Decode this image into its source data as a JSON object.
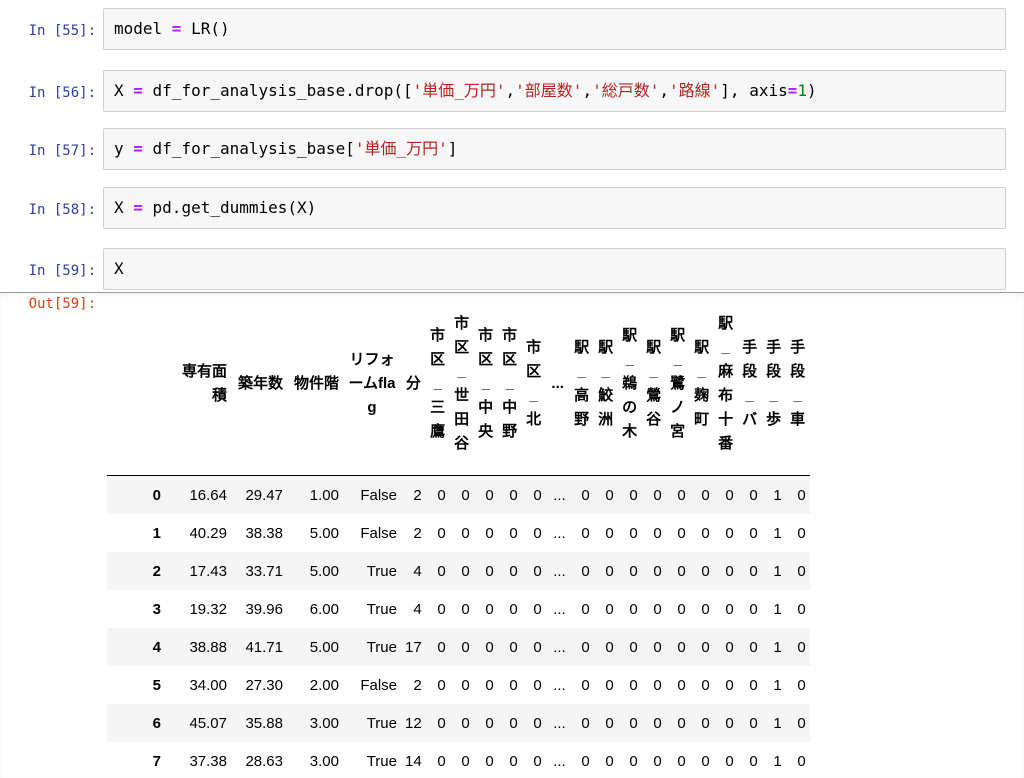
{
  "cells": [
    {
      "prompt": "In [55]:",
      "tokens": [
        [
          "t",
          "model "
        ],
        [
          "kw",
          "="
        ],
        [
          "t",
          " LR()"
        ]
      ]
    },
    {
      "prompt": "In [56]:",
      "tokens": [
        [
          "t",
          "X "
        ],
        [
          "kw",
          "="
        ],
        [
          "t",
          " df_for_analysis_base.drop(["
        ],
        [
          "str",
          "'単価_万円'"
        ],
        [
          "t",
          ","
        ],
        [
          "str",
          "'部屋数'"
        ],
        [
          "t",
          ","
        ],
        [
          "str",
          "'総戸数'"
        ],
        [
          "t",
          ","
        ],
        [
          "str",
          "'路線'"
        ],
        [
          "t",
          "], axis"
        ],
        [
          "kw",
          "="
        ],
        [
          "num",
          "1"
        ],
        [
          "t",
          ")"
        ]
      ]
    },
    {
      "prompt": "In [57]:",
      "tokens": [
        [
          "t",
          "y "
        ],
        [
          "kw",
          "="
        ],
        [
          "t",
          " df_for_analysis_base["
        ],
        [
          "str",
          "'単価_万円'"
        ],
        [
          "t",
          "]"
        ]
      ]
    },
    {
      "prompt": "In [58]:",
      "tokens": [
        [
          "t",
          "X "
        ],
        [
          "kw",
          "="
        ],
        [
          "t",
          " pd.get_dummies(X)"
        ]
      ]
    },
    {
      "prompt": "In [59]:",
      "tokens": [
        [
          "t",
          "X"
        ]
      ]
    }
  ],
  "output": {
    "prompt": "Out[59]:",
    "columns": [
      {
        "label": "専有面積",
        "style": "wrap"
      },
      {
        "label": "築年数",
        "style": "wrap"
      },
      {
        "label": "物件階",
        "style": "wrap"
      },
      {
        "label": "リフォームflag",
        "style": "reform"
      },
      {
        "label": "分",
        "style": "vt"
      },
      {
        "label": "市区_三鷹",
        "style": "vt"
      },
      {
        "label": "市区_世田谷",
        "style": "vt"
      },
      {
        "label": "市区_中央",
        "style": "vt"
      },
      {
        "label": "市区_中野",
        "style": "vt"
      },
      {
        "label": "市区_北",
        "style": "vt"
      },
      {
        "label": "...",
        "style": "vt"
      },
      {
        "label": "駅_高野",
        "style": "vt"
      },
      {
        "label": "駅_鮫洲",
        "style": "vt"
      },
      {
        "label": "駅_鵜の木",
        "style": "vt"
      },
      {
        "label": "駅_鶯谷",
        "style": "vt"
      },
      {
        "label": "駅_鷺ノ宮",
        "style": "vt"
      },
      {
        "label": "駅_麹町",
        "style": "vt"
      },
      {
        "label": "駅_麻布十番",
        "style": "vt"
      },
      {
        "label": "手段_バ",
        "style": "vt"
      },
      {
        "label": "手段_歩",
        "style": "vt"
      },
      {
        "label": "手段_車",
        "style": "vt"
      }
    ],
    "rows": [
      {
        "index": "0",
        "values": [
          "16.64",
          "29.47",
          "1.00",
          "False",
          "2",
          "0",
          "0",
          "0",
          "0",
          "0",
          "...",
          "0",
          "0",
          "0",
          "0",
          "0",
          "0",
          "0",
          "0",
          "1",
          "0"
        ]
      },
      {
        "index": "1",
        "values": [
          "40.29",
          "38.38",
          "5.00",
          "False",
          "2",
          "0",
          "0",
          "0",
          "0",
          "0",
          "...",
          "0",
          "0",
          "0",
          "0",
          "0",
          "0",
          "0",
          "0",
          "1",
          "0"
        ]
      },
      {
        "index": "2",
        "values": [
          "17.43",
          "33.71",
          "5.00",
          "True",
          "4",
          "0",
          "0",
          "0",
          "0",
          "0",
          "...",
          "0",
          "0",
          "0",
          "0",
          "0",
          "0",
          "0",
          "0",
          "1",
          "0"
        ]
      },
      {
        "index": "3",
        "values": [
          "19.32",
          "39.96",
          "6.00",
          "True",
          "4",
          "0",
          "0",
          "0",
          "0",
          "0",
          "...",
          "0",
          "0",
          "0",
          "0",
          "0",
          "0",
          "0",
          "0",
          "1",
          "0"
        ]
      },
      {
        "index": "4",
        "values": [
          "38.88",
          "41.71",
          "5.00",
          "True",
          "17",
          "0",
          "0",
          "0",
          "0",
          "0",
          "...",
          "0",
          "0",
          "0",
          "0",
          "0",
          "0",
          "0",
          "0",
          "1",
          "0"
        ]
      },
      {
        "index": "5",
        "values": [
          "34.00",
          "27.30",
          "2.00",
          "False",
          "2",
          "0",
          "0",
          "0",
          "0",
          "0",
          "...",
          "0",
          "0",
          "0",
          "0",
          "0",
          "0",
          "0",
          "0",
          "1",
          "0"
        ]
      },
      {
        "index": "6",
        "values": [
          "45.07",
          "35.88",
          "3.00",
          "True",
          "12",
          "0",
          "0",
          "0",
          "0",
          "0",
          "...",
          "0",
          "0",
          "0",
          "0",
          "0",
          "0",
          "0",
          "0",
          "1",
          "0"
        ]
      },
      {
        "index": "7",
        "values": [
          "37.38",
          "28.63",
          "3.00",
          "True",
          "14",
          "0",
          "0",
          "0",
          "0",
          "0",
          "...",
          "0",
          "0",
          "0",
          "0",
          "0",
          "0",
          "0",
          "0",
          "1",
          "0"
        ]
      }
    ]
  },
  "colors": {
    "prompt_in": "#303f9f",
    "prompt_out": "#d84315",
    "keyword": "#aa22ff",
    "string": "#ba2121",
    "number": "#008000"
  }
}
